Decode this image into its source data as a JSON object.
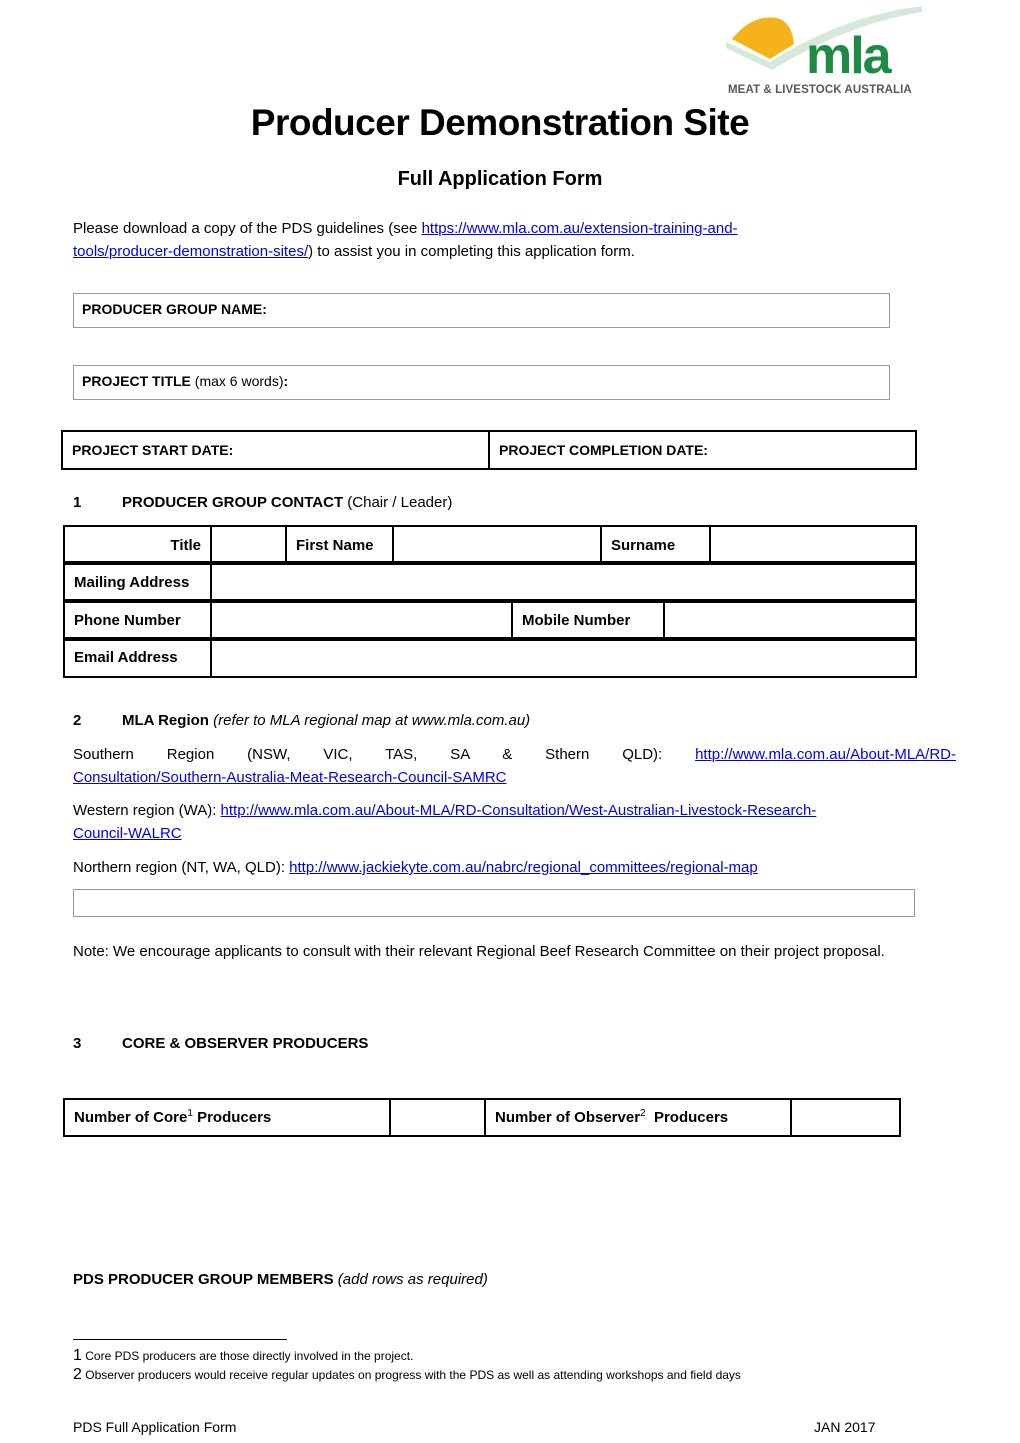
{
  "logo": {
    "wordmark": "mla",
    "tagline": "MEAT & LIVESTOCK AUSTRALIA",
    "colors": {
      "green": "#1e8a43",
      "sun": "#f5b21a",
      "swoosh": "#d6e8dc"
    }
  },
  "title": "Producer Demonstration Site",
  "subtitle": "Full Application Form",
  "intro": {
    "before": "Please download a copy of the PDS guidelines (see ",
    "link_line1": "https://www.mla.com.au/extension-training-and-",
    "link_line2": "tools/producer-demonstration-sites/",
    "after": ") to assist you in completing this application form."
  },
  "producer_group_name": {
    "label": "PRODUCER GROUP NAME:"
  },
  "project_title": {
    "label": "PROJECT TITLE",
    "hint": " (max 6 words)",
    "colon": ":"
  },
  "dates": {
    "start_label": "PROJECT START DATE:",
    "completion_label": "PROJECT COMPLETION DATE:"
  },
  "section1": {
    "number": "1",
    "title": "PRODUCER GROUP CONTACT",
    "note": " (Chair / Leader)",
    "fields": {
      "title": "Title",
      "first_name": "First Name",
      "surname": "Surname",
      "mailing_address": "Mailing Address",
      "phone_number": "Phone Number",
      "mobile_number": "Mobile Number",
      "email_address": "Email Address"
    }
  },
  "section2": {
    "number": "2",
    "title": "MLA Region",
    "note": " (refer to MLA regional map at www.mla.com.au)",
    "southern": {
      "label": "Southern Region (NSW, VIC, TAS, SA & Sthern QLD): ",
      "link_line1": "http://www.mla.com.au/About-MLA/RD-",
      "link_line2": "Consultation/Southern-Australia-Meat-Research-Council-SAMRC"
    },
    "western": {
      "label": "Western region (WA): ",
      "link_line1": "http://www.mla.com.au/About-MLA/RD-Consultation/West-Australian-Livestock-Research-",
      "link_line2": "Council-WALRC"
    },
    "northern": {
      "label": "Northern region (NT, WA, QLD): ",
      "link": "http://www.jackiekyte.com.au/nabrc/regional_committees/regional-map"
    }
  },
  "note": "Note: We encourage applicants to consult with their relevant Regional Beef Research Committee on their project proposal.",
  "section3": {
    "number": "3",
    "title": "CORE & OBSERVER PRODUCERS",
    "core_label_a": "Number of Core",
    "core_sup": "1",
    "core_label_b": " Producers",
    "observer_label_a": "Number of Observer",
    "observer_sup": "2",
    "observer_label_b": "  Producers"
  },
  "members": {
    "title": "PDS PRODUCER GROUP MEMBERS",
    "note": " (add rows as required)"
  },
  "footnotes": [
    {
      "n": "1",
      "text": " Core PDS producers are those directly involved in the project."
    },
    {
      "n": "2",
      "text": " Observer producers would receive regular updates on progress with the PDS as well as attending workshops and field days"
    }
  ],
  "footer": {
    "left": "PDS Full Application Form",
    "right": "JAN 2017"
  }
}
